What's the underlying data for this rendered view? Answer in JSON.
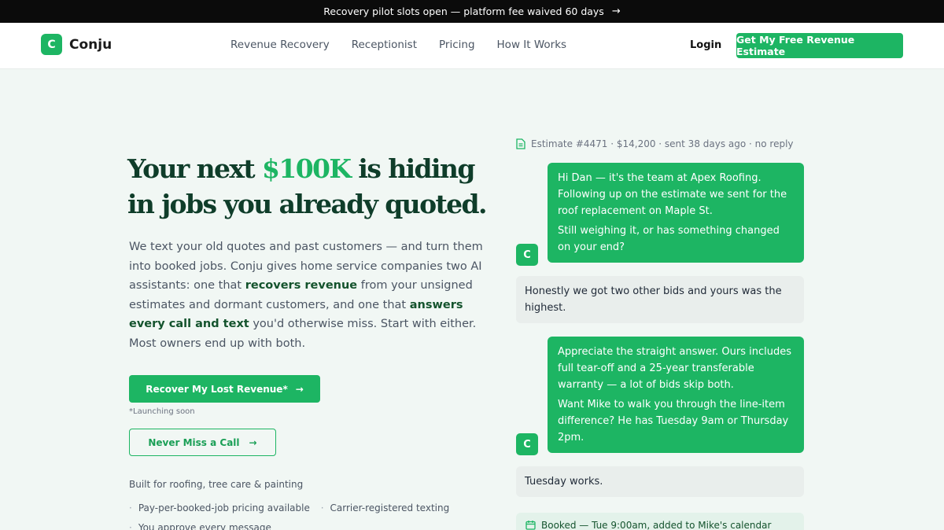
{
  "announcement": {
    "text": "Recovery pilot slots open — platform fee waived 60 days",
    "arrow": "→"
  },
  "nav": {
    "logo_letter": "C",
    "logo_text": "Conju",
    "links": [
      "Revenue Recovery",
      "Receptionist",
      "Pricing",
      "How It Works"
    ],
    "login": "Login",
    "cta": "Get My Free Revenue Estimate"
  },
  "hero": {
    "title_pre": "Your next ",
    "title_accent": "$100K",
    "title_post": " is hiding in jobs you already quoted.",
    "body_1": "We text your old quotes and past customers — and turn them into booked jobs. Conju gives home service companies two AI assistants: one that ",
    "body_b1": "recovers revenue",
    "body_2": " from your unsigned estimates and dormant customers, and one that ",
    "body_b2": "answers every call and text",
    "body_3": " you'd otherwise miss. Start with either. Most owners end up with both.",
    "primary_button": "Recover My Lost Revenue*",
    "launch_note": "*Launching soon",
    "secondary_button": "Never Miss a Call",
    "arrow": "→",
    "built_for": "Built for roofing, tree care & painting",
    "bullets": [
      "Pay-per-booked-job pricing available",
      "Carrier-registered texting",
      "You approve every message"
    ],
    "bullet_dot": "·"
  },
  "conversation": {
    "estimate_line": "Estimate #4471 · $14,200 · sent 38 days ago · no reply",
    "avatar_letter": "C",
    "msg1_p1": "Hi Dan — it's the team at Apex Roofing. Following up on the estimate we sent for the roof replacement on Maple St.",
    "msg1_p2": "Still weighing it, or has something changed on your end?",
    "reply1": "Honestly we got two other bids and yours was the highest.",
    "msg2_p1": "Appreciate the straight answer. Ours includes full tear-off and a 25-year transferable warranty — a lot of bids skip both.",
    "msg2_p2": "Want Mike to walk you through the line-item difference? He has Tuesday 9am or Thursday 2pm.",
    "reply2": "Tuesday works.",
    "booked": "Booked — Tue 9:00am, added to Mike's calendar"
  },
  "colors": {
    "brand": "#1db563",
    "heading": "#0f3d2a",
    "page_bg": "#f1f7f4",
    "inbound_bubble": "#e9eeec"
  },
  "icons": {
    "estimate": "document-icon",
    "booked": "calendar-icon",
    "arrow": "arrow-right-icon"
  }
}
